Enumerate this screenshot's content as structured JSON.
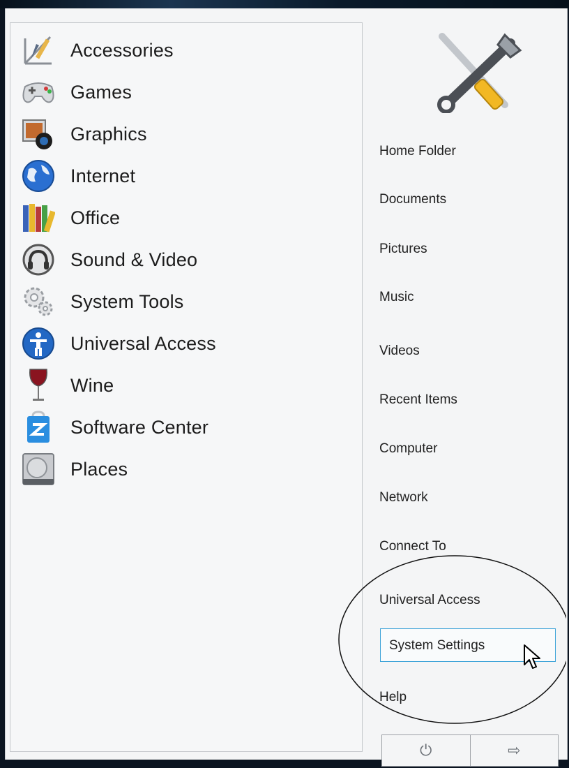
{
  "categories": [
    {
      "label": "Accessories",
      "icon": "accessories-icon"
    },
    {
      "label": "Games",
      "icon": "gamepad-icon"
    },
    {
      "label": "Graphics",
      "icon": "graphics-icon"
    },
    {
      "label": "Internet",
      "icon": "globe-icon"
    },
    {
      "label": "Office",
      "icon": "books-icon"
    },
    {
      "label": "Sound & Video",
      "icon": "headphones-icon"
    },
    {
      "label": "System Tools",
      "icon": "gears-icon"
    },
    {
      "label": "Universal Access",
      "icon": "accessibility-icon"
    },
    {
      "label": "Wine",
      "icon": "wine-glass-icon"
    },
    {
      "label": "Software Center",
      "icon": "software-center-icon"
    },
    {
      "label": "Places",
      "icon": "hard-drive-icon"
    }
  ],
  "places": [
    {
      "label": "Home Folder"
    },
    {
      "label": "Documents"
    },
    {
      "label": "Pictures"
    },
    {
      "label": "Music"
    },
    {
      "label": "Videos"
    },
    {
      "label": "Recent Items"
    },
    {
      "label": "Computer"
    },
    {
      "label": "Network"
    },
    {
      "label": "Connect To"
    },
    {
      "label": "Universal Access"
    },
    {
      "label": "System Settings",
      "selected": true
    },
    {
      "label": "Help"
    }
  ],
  "header_icon": "tools-icon",
  "power_buttons": [
    {
      "icon": "power-icon",
      "glyph": "⏻"
    },
    {
      "icon": "logout-icon",
      "glyph": "⇨"
    }
  ],
  "colors": {
    "selection_border": "#3aa2d8",
    "menu_background": "#f4f5f6"
  }
}
